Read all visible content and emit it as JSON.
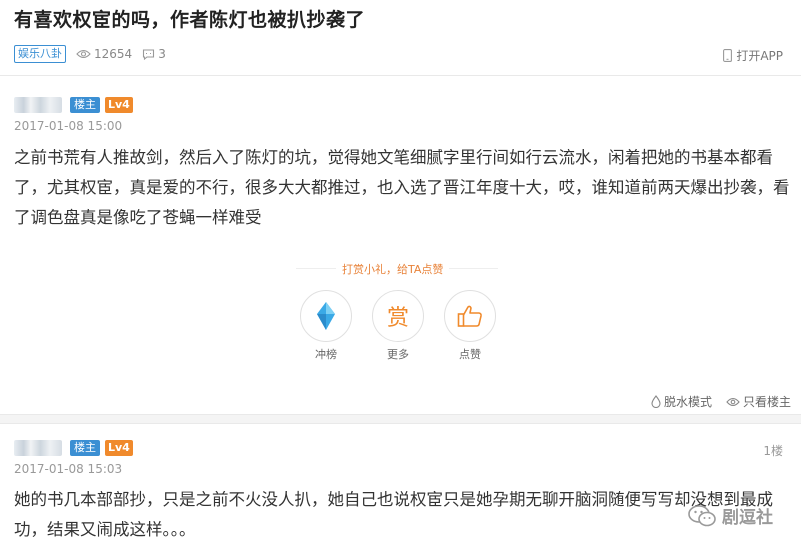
{
  "header": {
    "title": "有喜欢权宦的吗，作者陈灯也被扒抄袭了",
    "category_tag": "娱乐八卦",
    "views": "12654",
    "comments": "3",
    "open_app_label": "打开APP"
  },
  "posts": [
    {
      "host_badge": "楼主",
      "level_badge": "Lv4",
      "timestamp": "2017-01-08 15:00",
      "content": "之前书荒有人推故剑，然后入了陈灯的坑，觉得她文笔细腻字里行间如行云流水，闲着把她的书基本都看了，尤其权宦，真是爱的不行，很多大大都推过，也入选了晋江年度十大，哎，谁知道前两天爆出抄袭，看了调色盘真是像吃了苍蝇一样难受",
      "reward_title": "打赏小礼，给TA点赞",
      "actions": [
        {
          "icon": "diamond-icon",
          "label": "冲榜"
        },
        {
          "icon": "reward-icon",
          "label": "更多",
          "glyph": "赏"
        },
        {
          "icon": "thumbs-up-icon",
          "label": "点赞"
        }
      ],
      "footer_actions": [
        {
          "icon": "water-drop-icon",
          "label": "脱水模式"
        },
        {
          "icon": "eye-icon",
          "label": "只看楼主"
        }
      ]
    },
    {
      "host_badge": "楼主",
      "level_badge": "Lv4",
      "timestamp": "2017-01-08 15:03",
      "floor": "1楼",
      "content": "她的书几本部部抄，只是之前不火没人扒，她自己也说权宦只是她孕期无聊开脑洞随便写写却没想到最成功，结果又闹成这样。。。"
    }
  ],
  "watermark": "剧逗社",
  "colors": {
    "accent_blue": "#3b8fd3",
    "level_orange": "#f08a2c",
    "reward_orange": "#e8833a",
    "diamond_blue": "#3aa9e6"
  }
}
